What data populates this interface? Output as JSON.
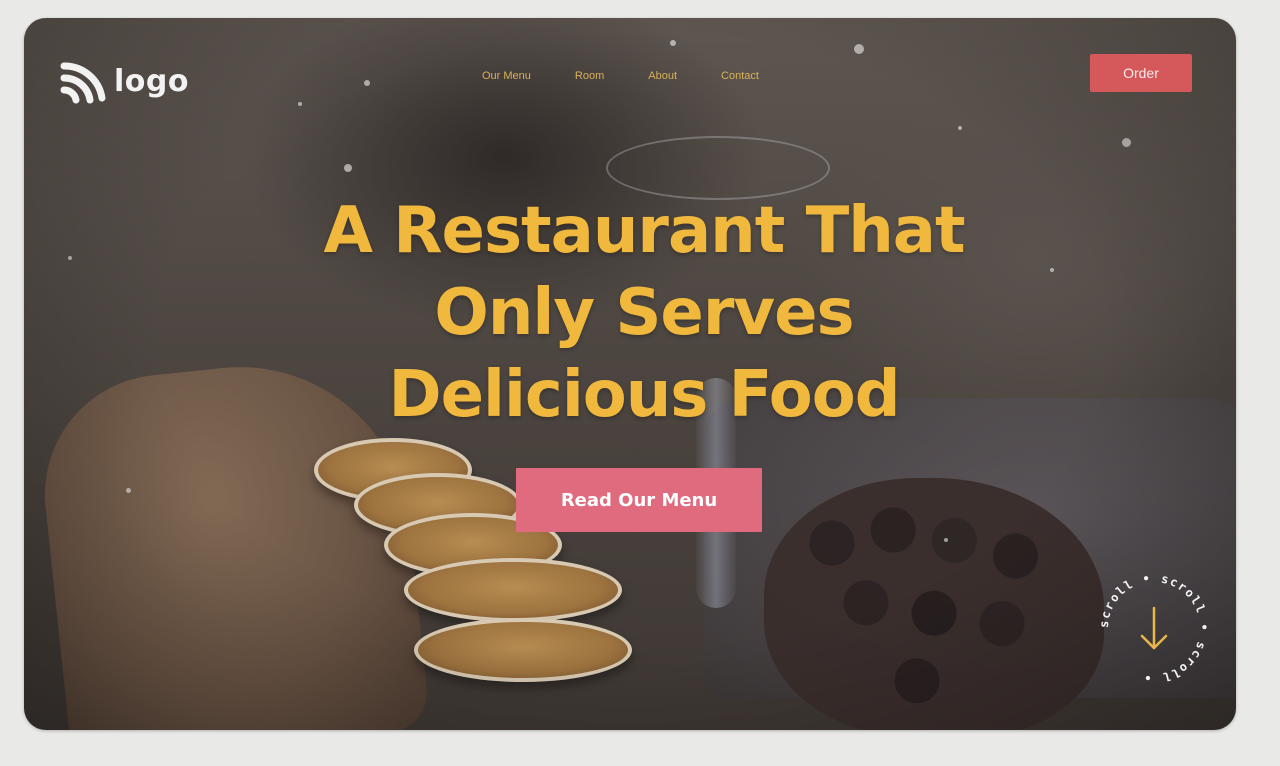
{
  "header": {
    "logo_text": "logo",
    "nav": [
      "Our Menu",
      "Room",
      "About",
      "Contact"
    ],
    "order_label": "Order"
  },
  "hero": {
    "title_lines": [
      "A Restaurant That",
      "Only Serves",
      "Delicious Food"
    ],
    "cta_label": "Read Our Menu"
  },
  "scroll_badge": {
    "text": "scroll • scroll • scroll •"
  },
  "colors": {
    "accent_yellow": "#f0b93e",
    "order_button": "#d5585a",
    "cta_button": "#e06a7e",
    "nav_text": "#d8b15a"
  },
  "icons": {
    "logo": "wifi-signal-icon",
    "scroll": "arrow-down-icon"
  }
}
